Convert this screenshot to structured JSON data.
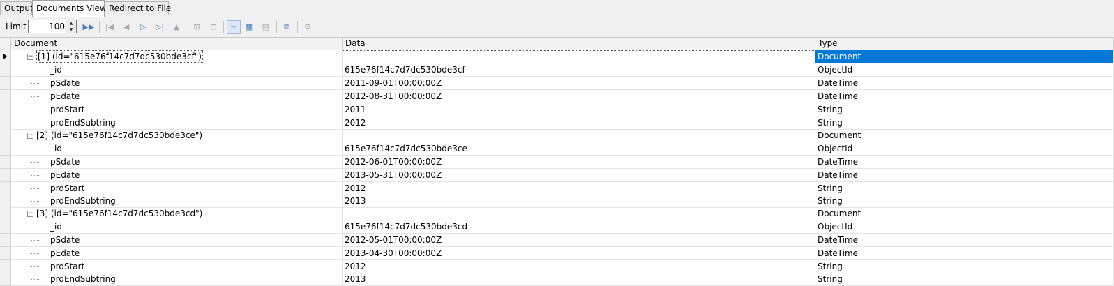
{
  "tabs": [
    {
      "label": "Output"
    },
    {
      "label": "Documents View"
    },
    {
      "label": "Redirect to File"
    }
  ],
  "toolbar": {
    "limit_label": "Limit",
    "limit_value": "100",
    "icons": [
      "fetch-next-icon",
      "first-page-icon",
      "previous-icon",
      "next-icon",
      "last-page-icon",
      "go-up-icon",
      "expand-all-icon",
      "collapse-all-icon",
      "tree-view-icon",
      "table-view-icon",
      "text-view-icon",
      "export-icon",
      "settings-icon"
    ]
  },
  "columns": {
    "document": "Document",
    "data": "Data",
    "type": "Type"
  },
  "rows": [
    {
      "label": "[1] (id=\"615e76f14c7d7dc530bde3cf\")",
      "data": "",
      "type": "Document"
    },
    {
      "label": "_id",
      "data": "615e76f14c7d7dc530bde3cf",
      "type": "ObjectId"
    },
    {
      "label": "pSdate",
      "data": "2011-09-01T00:00:00Z",
      "type": "DateTime"
    },
    {
      "label": "pEdate",
      "data": "2012-08-31T00:00:00Z",
      "type": "DateTime"
    },
    {
      "label": "prdStart",
      "data": "2011",
      "type": "String"
    },
    {
      "label": "prdEndSubtring",
      "data": "2012",
      "type": "String"
    },
    {
      "label": "[2] (id=\"615e76f14c7d7dc530bde3ce\")",
      "data": "",
      "type": "Document"
    },
    {
      "label": "_id",
      "data": "615e76f14c7d7dc530bde3ce",
      "type": "ObjectId"
    },
    {
      "label": "pSdate",
      "data": "2012-06-01T00:00:00Z",
      "type": "DateTime"
    },
    {
      "label": "pEdate",
      "data": "2013-05-31T00:00:00Z",
      "type": "DateTime"
    },
    {
      "label": "prdStart",
      "data": "2012",
      "type": "String"
    },
    {
      "label": "prdEndSubtring",
      "data": "2013",
      "type": "String"
    },
    {
      "label": "[3] (id=\"615e76f14c7d7dc530bde3cd\")",
      "data": "",
      "type": "Document"
    },
    {
      "label": "_id",
      "data": "615e76f14c7d7dc530bde3cd",
      "type": "ObjectId"
    },
    {
      "label": "pSdate",
      "data": "2012-05-01T00:00:00Z",
      "type": "DateTime"
    },
    {
      "label": "pEdate",
      "data": "2013-04-30T00:00:00Z",
      "type": "DateTime"
    },
    {
      "label": "prdStart",
      "data": "2012",
      "type": "String"
    },
    {
      "label": "prdEndSubtring",
      "data": "2013",
      "type": "String"
    }
  ]
}
